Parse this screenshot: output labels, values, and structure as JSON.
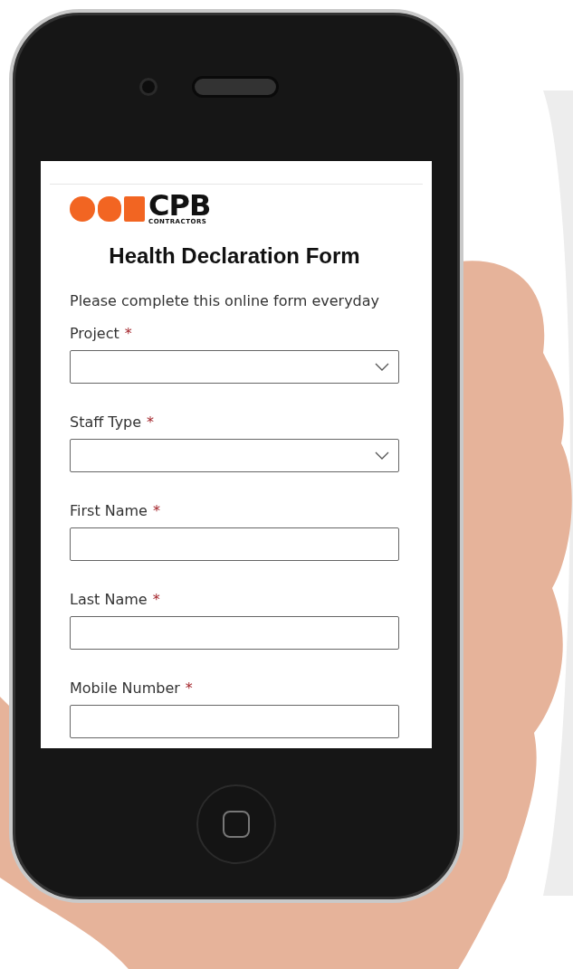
{
  "logo": {
    "wordmark": "CPB",
    "subtitle": "CONTRACTORS"
  },
  "form": {
    "title": "Health Declaration Form",
    "instruction": "Please complete this online form everyday",
    "fields": [
      {
        "label": "Project",
        "required_mark": "*",
        "kind": "select"
      },
      {
        "label": "Staff Type",
        "required_mark": "*",
        "kind": "select"
      },
      {
        "label": "First Name",
        "required_mark": "*",
        "kind": "text"
      },
      {
        "label": "Last Name",
        "required_mark": "*",
        "kind": "text"
      },
      {
        "label": "Mobile Number",
        "required_mark": "*",
        "kind": "text"
      }
    ]
  }
}
